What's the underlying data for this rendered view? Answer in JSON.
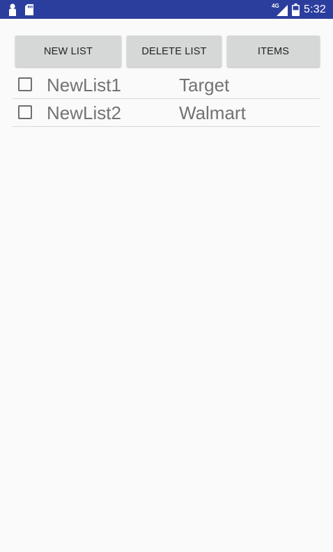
{
  "status_bar": {
    "time": "5:32",
    "network": "4G",
    "icons": [
      "person-icon",
      "sd-card-icon",
      "signal-icon",
      "battery-icon"
    ]
  },
  "toolbar": {
    "new_list_label": "NEW LIST",
    "delete_list_label": "DELETE LIST",
    "items_label": "ITEMS"
  },
  "lists": [
    {
      "name": "NewList1",
      "store": "Target",
      "checked": false
    },
    {
      "name": "NewList2",
      "store": "Walmart",
      "checked": false
    }
  ],
  "colors": {
    "status_bar": "#2c3e9d",
    "background": "#fafafa",
    "button": "#d6d7d7",
    "text": "#737373"
  }
}
